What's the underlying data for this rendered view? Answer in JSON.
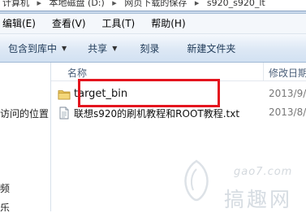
{
  "address_bar": {
    "segments": [
      "计算机",
      "本地磁盘 (D:)",
      "网页下载的保存",
      "s920_s920_lt"
    ]
  },
  "menu": {
    "items": [
      "编辑(E)",
      "查看(V)",
      "工具(T)",
      "帮助(H)"
    ]
  },
  "toolbar": {
    "include_in_library": "包含到库中",
    "share": "共享",
    "burn": "刻录",
    "new_folder": "新建文件夹"
  },
  "nav_pane": {
    "item_recent": "访问的位置",
    "item_videos": "频",
    "item_music": "乐"
  },
  "columns": {
    "name": "名称",
    "date_modified": "修改日期"
  },
  "files": [
    {
      "name": "target_bin",
      "type": "folder",
      "date": "2013/9/"
    },
    {
      "name": "联想s920的刷机教程和ROOT教程.txt",
      "type": "txt",
      "date": "2013/8/"
    }
  ],
  "watermark": {
    "url": "gao7.com",
    "site": "搞趣网"
  },
  "colors": {
    "highlight_box": "#e4141e",
    "folder": "#e8c45a"
  }
}
